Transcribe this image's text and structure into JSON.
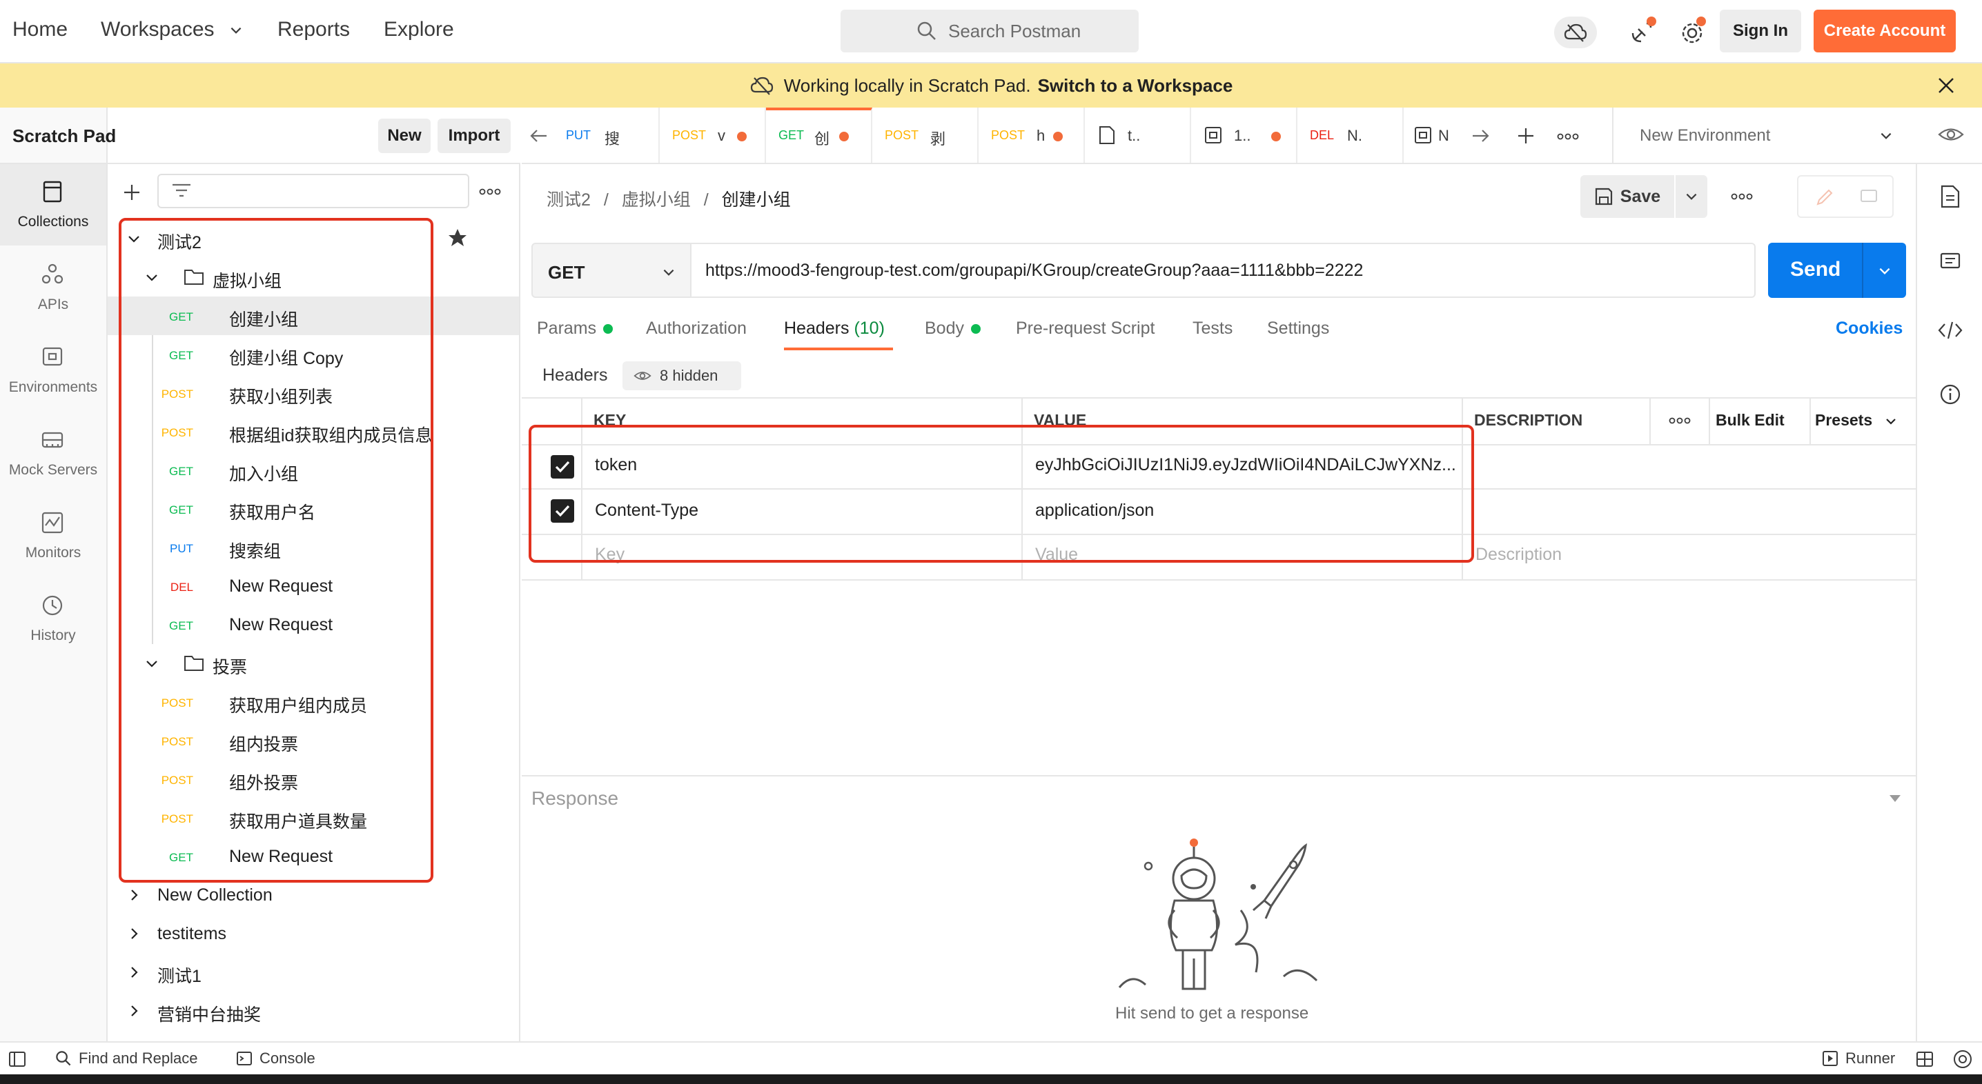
{
  "topnav": {
    "home": "Home",
    "workspaces": "Workspaces",
    "reports": "Reports",
    "explore": "Explore",
    "search_placeholder": "Search Postman",
    "sign_in": "Sign In",
    "create_account": "Create Account"
  },
  "banner": {
    "text": "Working locally in Scratch Pad.",
    "link": "Switch to a Workspace"
  },
  "rail": {
    "items": [
      {
        "label": "Collections",
        "icon": "collections-icon"
      },
      {
        "label": "APIs",
        "icon": "apis-icon"
      },
      {
        "label": "Environments",
        "icon": "environments-icon"
      },
      {
        "label": "Mock Servers",
        "icon": "mock-servers-icon"
      },
      {
        "label": "Monitors",
        "icon": "monitors-icon"
      },
      {
        "label": "History",
        "icon": "history-icon"
      }
    ]
  },
  "sidebar": {
    "title": "Scratch Pad",
    "new_label": "New",
    "import_label": "Import",
    "collection": "测试2",
    "folder1": "虚拟小组",
    "folder2": "投票",
    "f1_items": [
      {
        "method": "GET",
        "name": "创建小组"
      },
      {
        "method": "GET",
        "name": "创建小组 Copy"
      },
      {
        "method": "POST",
        "name": "获取小组列表"
      },
      {
        "method": "POST",
        "name": "根据组id获取组内成员信息"
      },
      {
        "method": "GET",
        "name": "加入小组"
      },
      {
        "method": "GET",
        "name": "获取用户名"
      },
      {
        "method": "PUT",
        "name": "搜索组"
      },
      {
        "method": "DEL",
        "name": "New Request"
      },
      {
        "method": "GET",
        "name": "New Request"
      }
    ],
    "f2_items": [
      {
        "method": "POST",
        "name": "获取用户组内成员"
      },
      {
        "method": "POST",
        "name": "组内投票"
      },
      {
        "method": "POST",
        "name": "组外投票"
      },
      {
        "method": "POST",
        "name": "获取用户道具数量"
      },
      {
        "method": "GET",
        "name": "New Request"
      }
    ],
    "other_collections": [
      "New Collection",
      "testitems",
      "测试1",
      "营销中台抽奖"
    ]
  },
  "tabs": [
    {
      "method": "PUT",
      "title": "搜"
    },
    {
      "method": "POST",
      "title": "v"
    },
    {
      "method": "GET",
      "title": "创"
    },
    {
      "method": "POST",
      "title": "剥"
    },
    {
      "method": "POST",
      "title": "h"
    },
    {
      "method": "",
      "title": "t.."
    },
    {
      "method": "",
      "title": "1.."
    },
    {
      "method": "DEL",
      "title": "N."
    },
    {
      "method": "",
      "title": "N"
    }
  ],
  "environment": "New Environment",
  "breadcrumb": {
    "c1": "测试2",
    "c2": "虚拟小组",
    "current": "创建小组"
  },
  "save_label": "Save",
  "request": {
    "method": "GET",
    "url": "https://mood3-fengroup-test.com/groupapi/KGroup/createGroup?aaa=1111&bbb=2222",
    "send": "Send"
  },
  "request_tabs": {
    "params": "Params",
    "authorization": "Authorization",
    "headers": "Headers",
    "headers_count": "(10)",
    "body": "Body",
    "prerequest": "Pre-request Script",
    "tests": "Tests",
    "settings": "Settings",
    "cookies": "Cookies"
  },
  "headers_section": {
    "label": "Headers",
    "hidden": "8 hidden",
    "col_key": "KEY",
    "col_value": "VALUE",
    "col_desc": "DESCRIPTION",
    "bulk_edit": "Bulk Edit",
    "presets": "Presets",
    "rows": [
      {
        "key": "token",
        "value": "eyJhbGciOiJIUzI1NiJ9.eyJzdWIiOiI4NDAiLCJwYXNz..."
      },
      {
        "key": "Content-Type",
        "value": "application/json"
      }
    ],
    "ph_key": "Key",
    "ph_value": "Value",
    "ph_desc": "Description"
  },
  "response": {
    "label": "Response",
    "hint": "Hit send to get a response"
  },
  "bottom": {
    "find_replace": "Find and Replace",
    "console": "Console",
    "runner": "Runner"
  },
  "colors": {
    "accent": "#ff6c37",
    "send": "#097bed",
    "banner": "#fbe89a",
    "highlight_box": "#e2321f"
  }
}
